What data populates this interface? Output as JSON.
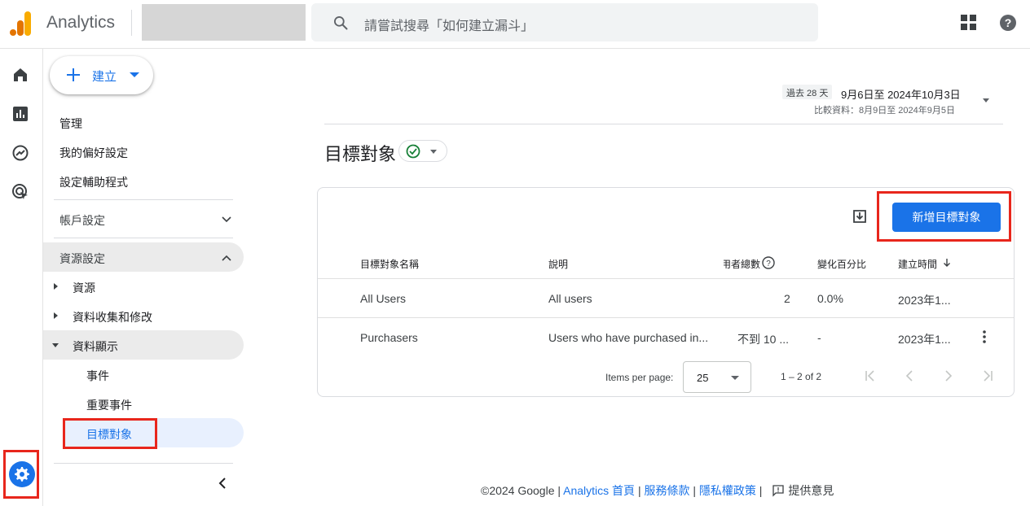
{
  "app": {
    "brand": "Analytics"
  },
  "search": {
    "placeholder": "請嘗試搜尋「如何建立漏斗」"
  },
  "nav": {
    "create_label": "建立",
    "top_items": [
      "管理",
      "我的偏好設定",
      "設定輔助程式"
    ],
    "account_settings": "帳戶設定",
    "property_settings": "資源設定",
    "property_children": [
      "資源",
      "資料收集和修改",
      "資料顯示"
    ],
    "display_children": [
      "事件",
      "重要事件",
      "目標對象"
    ]
  },
  "date": {
    "range_tag": "過去 28 天",
    "range": "9月6日至 2024年10月3日",
    "compare": "比較資料：8月9日至 2024年9月5日"
  },
  "page": {
    "title": "目標對象"
  },
  "toolbar": {
    "new_audience_label": "新增目標對象"
  },
  "table": {
    "headers": [
      "目標對象名稱",
      "說明",
      "用者總數",
      "變化百分比",
      "建立時間"
    ],
    "rows": [
      {
        "name": "All Users",
        "desc": "All users",
        "users": "2",
        "change": "0.0%",
        "created": "2023年1..."
      },
      {
        "name": "Purchasers",
        "desc": "Users who have purchased in...",
        "users": "不到 10 ...",
        "change": "-",
        "created": "2023年1..."
      }
    ]
  },
  "pagination": {
    "items_per_page_label": "Items per page:",
    "items_per_page": "25",
    "range": "1 – 2 of 2"
  },
  "footer": {
    "copyright": "©2024 Google | ",
    "home": "Analytics 首頁",
    "sep": " | ",
    "terms": "服務條款",
    "privacy": "隱私權政策",
    "sep2": " | ",
    "feedback": "提供意見"
  },
  "colors": {
    "accent": "#1a73e8",
    "highlight_box": "#e8261c"
  }
}
